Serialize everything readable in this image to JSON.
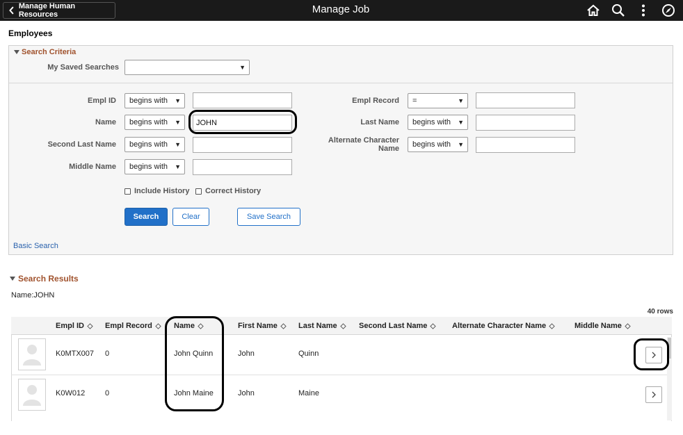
{
  "header": {
    "back_label": "Manage Human Resources",
    "title": "Manage Job",
    "icons": [
      "home-icon",
      "search-icon",
      "more-icon",
      "navbar-icon"
    ]
  },
  "page": {
    "title": "Employees"
  },
  "criteria": {
    "section_label": "Search Criteria",
    "saved_searches_label": "My Saved Searches",
    "saved_searches_value": "",
    "fields": {
      "empl_id": {
        "label": "Empl ID",
        "operator": "begins with",
        "value": ""
      },
      "name": {
        "label": "Name",
        "operator": "begins with",
        "value": "JOHN"
      },
      "second_last_name": {
        "label": "Second Last Name",
        "operator": "begins with",
        "value": ""
      },
      "middle_name": {
        "label": "Middle Name",
        "operator": "begins with",
        "value": ""
      },
      "empl_record": {
        "label": "Empl Record",
        "operator": "=",
        "value": ""
      },
      "last_name": {
        "label": "Last Name",
        "operator": "begins with",
        "value": ""
      },
      "alt_char_name": {
        "label_line1": "Alternate Character",
        "label_line2": "Name",
        "operator": "begins with",
        "value": ""
      }
    },
    "include_history_label": "Include History",
    "correct_history_label": "Correct History",
    "search_button": "Search",
    "clear_button": "Clear",
    "save_search_button": "Save Search",
    "basic_search_link": "Basic Search"
  },
  "results": {
    "section_label": "Search Results",
    "filter_text": "Name:JOHN",
    "rows_count": "40 rows",
    "columns": [
      "Empl ID",
      "Empl Record",
      "Name",
      "First Name",
      "Last Name",
      "Second Last Name",
      "Alternate Character Name",
      "Middle Name"
    ],
    "rows": [
      {
        "empl_id": "K0MTX007",
        "empl_record": "0",
        "name": "John Quinn",
        "first_name": "John",
        "last_name": "Quinn",
        "second_last_name": "",
        "alt_char_name": "",
        "middle_name": ""
      },
      {
        "empl_id": "K0W012",
        "empl_record": "0",
        "name": "John Maine",
        "first_name": "John",
        "last_name": "Maine",
        "second_last_name": "",
        "alt_char_name": "",
        "middle_name": ""
      }
    ]
  },
  "colors": {
    "header_bg": "#1a1a1a",
    "section_label": "#a0522d",
    "primary_button": "#2170c8",
    "link": "#2a62ad"
  }
}
